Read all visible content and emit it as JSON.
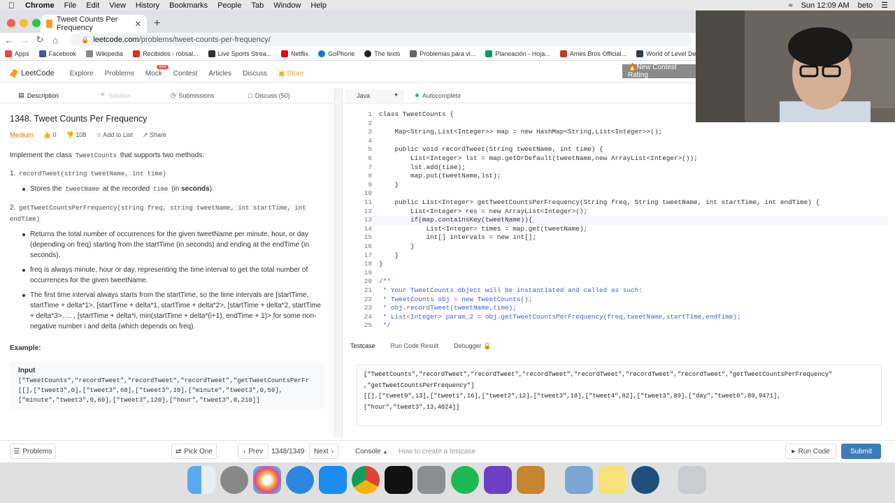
{
  "menubar": {
    "app": "Chrome",
    "items": [
      "File",
      "Edit",
      "View",
      "History",
      "Bookmarks",
      "People",
      "Tab",
      "Window",
      "Help"
    ],
    "clock": "Sun 12:09 AM",
    "user": "beto"
  },
  "browser": {
    "tab_title": "Tweet Counts Per Frequency",
    "url_host": "leetcode.com",
    "url_path": "/problems/tweet-counts-per-frequency/"
  },
  "bookmarks": [
    {
      "label": "Apps",
      "color": "#e44"
    },
    {
      "label": "Facebook",
      "color": "#3b5998"
    },
    {
      "label": "Wikipedia",
      "color": "#888"
    },
    {
      "label": "Recibidos - robsal...",
      "color": "#d93025"
    },
    {
      "label": "Live Sports Strea...",
      "color": "#333"
    },
    {
      "label": "Netflix",
      "color": "#e50914"
    },
    {
      "label": "GoPhone",
      "color": "#0a7fd1"
    },
    {
      "label": "The texts",
      "color": "#222"
    },
    {
      "label": "Problemas para vi...",
      "color": "#666"
    },
    {
      "label": "Planeación - Hoja...",
      "color": "#0f9d58"
    },
    {
      "label": "Ames Bros Official...",
      "color": "#c0392b"
    },
    {
      "label": "World of Level De...",
      "color": "#2c3e50"
    }
  ],
  "lcnav": {
    "brand": "LeetCode",
    "items": [
      "Explore",
      "Problems",
      "Mock",
      "Contest",
      "Articles",
      "Discuss"
    ],
    "store": "Store",
    "new_badge": "new",
    "contest_btn": "🔥New Contest Rating"
  },
  "left": {
    "tabs": [
      "Description",
      "Solution",
      "Submissions",
      "Discuss (50)"
    ],
    "title": "1348. Tweet Counts Per Frequency",
    "difficulty": "Medium",
    "likes": "0",
    "dislikes": "108",
    "add_to_list": "Add to List",
    "share": "Share",
    "intro_pre": "Implement the class",
    "intro_code": "TweetCounts",
    "intro_post": "that supports two methods:",
    "m1_num": "1.",
    "m1_sig": "recordTweet(string tweetName, int time)",
    "m1_b1_a": "Stores the",
    "m1_b1_c1": "tweetName",
    "m1_b1_b": "at the recorded",
    "m1_b1_c2": "time",
    "m1_b1_d": "(in",
    "m1_b1_e": "seconds",
    "m1_b1_f": ").",
    "m2_num": "2.",
    "m2_sig": "getTweetCountsPerFrequency(string freq, string tweetName, int startTime, int endTime)",
    "m2_b1": "Returns the total number of occurrences for the given tweetName per minute, hour, or day (depending on freq) starting from the startTime (in seconds) and ending at the endTime (in seconds).",
    "m2_b2": "freq is always minute, hour or day, representing the time interval to get the total number of occurrences for the given tweetName.",
    "m2_b3": "The first time interval always starts from the startTime, so the time intervals are [startTime, startTime + delta*1>, [startTime + delta*1, startTime + delta*2>, [startTime + delta*2, startTime + delta*3>, ... , [startTime + delta*i, min(startTime + delta*(i+1), endTime + 1)> for some non-negative number i and delta (which depends on freq).",
    "example_label": "Example:",
    "input_label": "Input",
    "input_lines": [
      "[\"TweetCounts\",\"recordTweet\",\"recordTweet\",\"recordTweet\",\"getTweetCountsPerFr",
      "[[],[\"tweet3\",0],[\"tweet3\",60],[\"tweet3\",10],[\"minute\",\"tweet3\",0,59],",
      "[\"minute\",\"tweet3\",0,60],[\"tweet3\",120],[\"hour\",\"tweet3\",0,210]]"
    ]
  },
  "editor": {
    "language": "Java",
    "autocomplete": "Autocomplete",
    "lines": [
      "class TweetCounts {",
      "",
      "    Map<String,List<Integer>> map = new HashMap<String,List<Integer>>();",
      "",
      "    public void recordTweet(String tweetName, int time) {",
      "        List<Integer> lst = map.getOrDefault(tweetName,new ArrayList<Integer>());",
      "        lst.add(time);",
      "        map.put(tweetName,lst);",
      "    }",
      "",
      "    public List<Integer> getTweetCountsPerFrequency(String freq, String tweetName, int startTime, int endTime) {",
      "        List<Integer> res = new ArrayList<Integer>();",
      "        if(map.containsKey(tweetName)){",
      "            List<Integer> times = map.get(tweetName);",
      "            int[] intervals = new int[];",
      "        }",
      "    }",
      "}",
      "",
      "/**",
      " * Your TweetCounts object will be instantiated and called as such:",
      " * TweetCounts obj = new TweetCounts();",
      " * obj.recordTweet(tweetName,time);",
      " * List<Integer> param_2 = obj.getTweetCountsPerFrequency(freq,tweetName,startTime,endTime);",
      " */"
    ]
  },
  "console": {
    "tabs": [
      "Testcase",
      "Run Code Result",
      "Debugger 🔒"
    ],
    "testcase": [
      "[\"TweetCounts\",\"recordTweet\",\"recordTweet\",\"recordTweet\",\"recordTweet\",\"recordTweet\",\"recordTweet\",\"getTweetCountsPerFrequency\"",
      ",\"getTweetCountsPerFrequency\"]",
      "[[],[\"tweet0\",13],[\"tweet1\",16],[\"tweet2\",12],[\"tweet3\",18],[\"tweet4\",82],[\"tweet3\",89],[\"day\",\"tweet0\",89,9471],[\"hour\",\"tweet3\",13,4024]]"
    ]
  },
  "bottom": {
    "problems": "Problems",
    "pick_one": "Pick One",
    "prev": "Prev",
    "counter": "1348/1349",
    "next": "Next",
    "console": "Console",
    "how_to": "How to create a testcase",
    "run": "Run Code",
    "submit": "Submit"
  }
}
